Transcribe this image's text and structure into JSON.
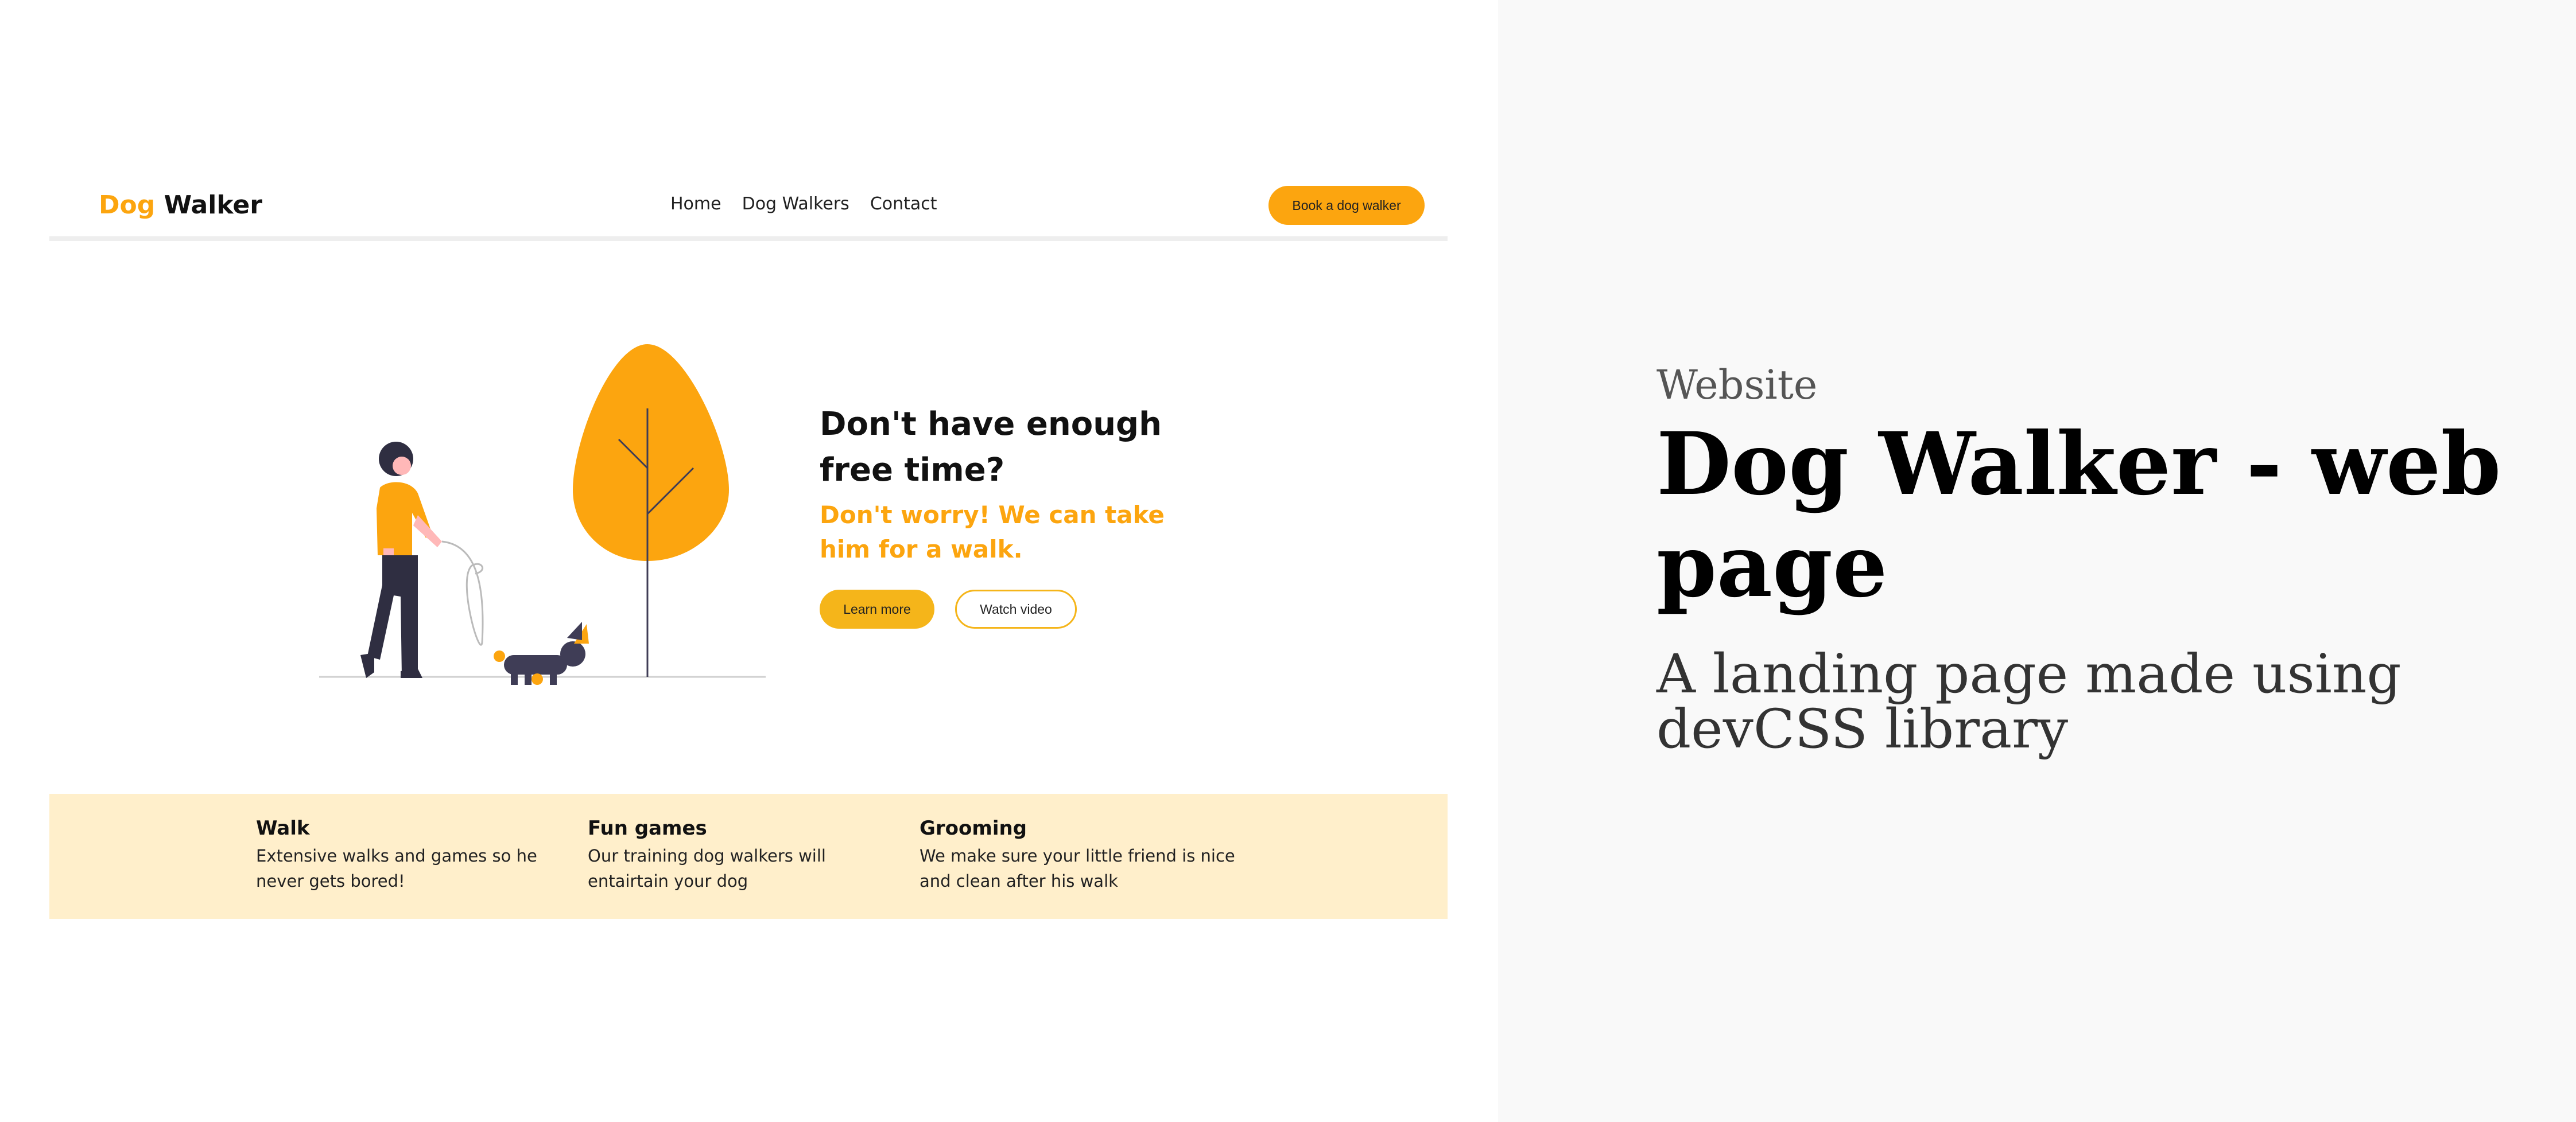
{
  "navbar": {
    "logo_accent": "Dog",
    "logo_rest": "Walker",
    "links": [
      "Home",
      "Dog Walkers",
      "Contact"
    ],
    "cta": "Book a dog walker"
  },
  "hero": {
    "title": "Don't have enough free time?",
    "subtitle": "Don't worry! We can take him for a walk.",
    "primary_button": "Learn more",
    "secondary_button": "Watch video"
  },
  "features": [
    {
      "title": "Walk",
      "text": "Extensive walks and games so he never gets bored!"
    },
    {
      "title": "Fun games",
      "text": "Our training dog walkers will entairtain your dog"
    },
    {
      "title": "Grooming",
      "text": "We make sure your little friend is nice and clean after his walk"
    }
  ],
  "info": {
    "kicker": "Website",
    "title": "Dog Walker - web page",
    "description": "A landing page made using devCSS library"
  },
  "colors": {
    "accent": "#fca50f",
    "button": "#f5b51a",
    "feature_band": "#ffefcb",
    "dark": "#3f3d56"
  }
}
